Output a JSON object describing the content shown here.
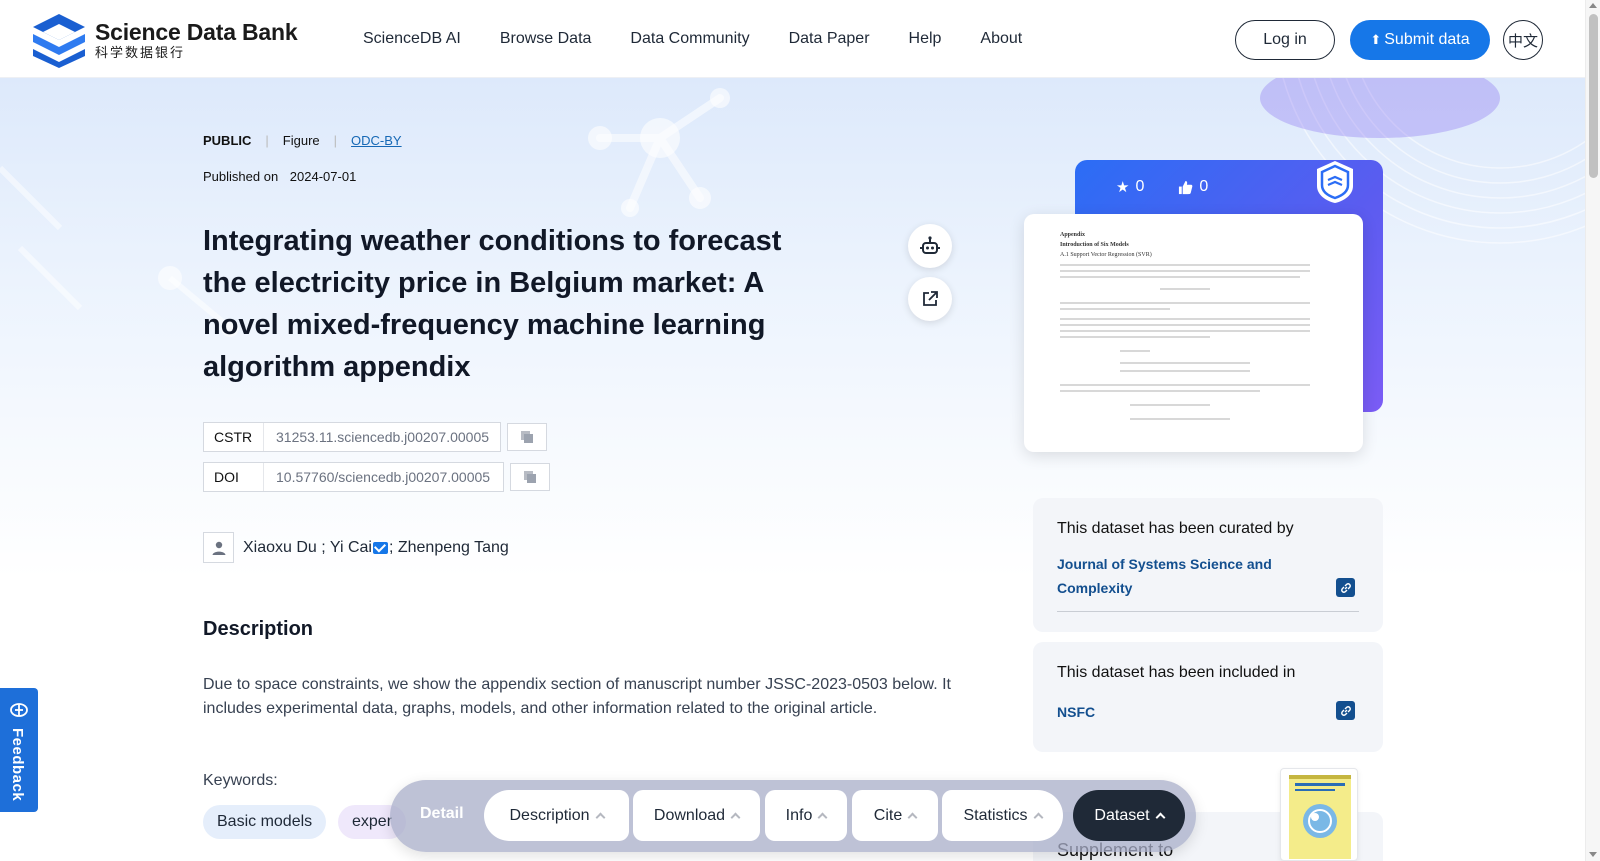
{
  "brand": {
    "name_en": "Science Data Bank",
    "name_cn": "科学数据银行"
  },
  "nav": [
    "ScienceDB AI",
    "Browse Data",
    "Data Community",
    "Data Paper",
    "Help",
    "About"
  ],
  "header": {
    "login": "Log in",
    "submit": "Submit data",
    "lang": "中文"
  },
  "meta": {
    "access": "PUBLIC",
    "type": "Figure",
    "license": "ODC-BY",
    "published_label": "Published on",
    "published_date": "2024-07-01"
  },
  "title": "Integrating weather conditions to forecast the electricity price in Belgium market: A novel mixed-frequency machine learning algorithm appendix",
  "identifiers": {
    "cstr_label": "CSTR",
    "cstr_value": "31253.11.sciencedb.j00207.00005",
    "doi_label": "DOI",
    "doi_value": "10.57760/sciencedb.j00207.00005"
  },
  "authors": {
    "a1": "Xiaoxu Du ; Yi Cai",
    "a2": "; Zhenpeng Tang"
  },
  "description": {
    "heading": "Description",
    "text": "Due to space constraints, we show the appendix section of manuscript number JSSC-2023-0503 below. It includes experimental data, graphs, models, and other information related to the original article."
  },
  "keywords": {
    "label": "Keywords:",
    "items": [
      "Basic models",
      "exper"
    ]
  },
  "stats": {
    "stars": "0",
    "likes": "0"
  },
  "curated": {
    "heading": "This dataset has been curated by",
    "link": "Journal of Systems Science and Complexity"
  },
  "included": {
    "heading": "This dataset has been included in",
    "link": "NSFC"
  },
  "supplement": {
    "heading": "Supplement to"
  },
  "feedback": "Feedback",
  "bottom_bar": {
    "detail": "Detail",
    "buttons": [
      "Description",
      "Download",
      "Info",
      "Cite",
      "Statistics",
      "Dataset"
    ]
  },
  "preview_doc": {
    "heading1": "Appendix",
    "heading2": "Introduction of Six Models",
    "heading3": "A.1 Support Vector Regression (SVR)"
  },
  "colors": {
    "primary": "#1677e8",
    "dark": "#1f2937",
    "link": "#134f8f",
    "card_bg": "#f3f5f9"
  }
}
